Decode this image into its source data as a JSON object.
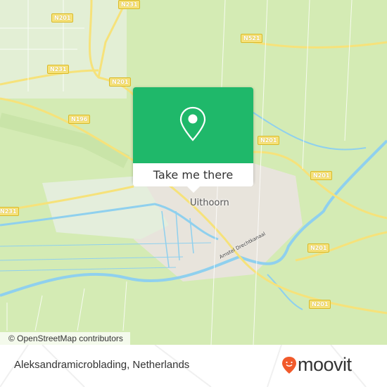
{
  "map": {
    "town_label": "Uithoorn",
    "canal_label": "Amstel Drechtkanaal",
    "road_shields": [
      "N231",
      "N201",
      "N521",
      "N231",
      "N201",
      "N196",
      "N201",
      "N201",
      "N231",
      "N201",
      "N201"
    ],
    "attribution": "© OpenStreetMap contributors",
    "colors": {
      "land": "#d4ebb4",
      "water": "#8fd0ee",
      "urban": "#e8e4dc",
      "road": "#f6e27a"
    }
  },
  "popup": {
    "icon": "map-pin-icon",
    "button_label": "Take me there",
    "color": "#1fb86a"
  },
  "footer": {
    "place_name": "Aleksandramicroblading, Netherlands",
    "logo_text": "moovit",
    "logo_color": "#f15a2b"
  }
}
